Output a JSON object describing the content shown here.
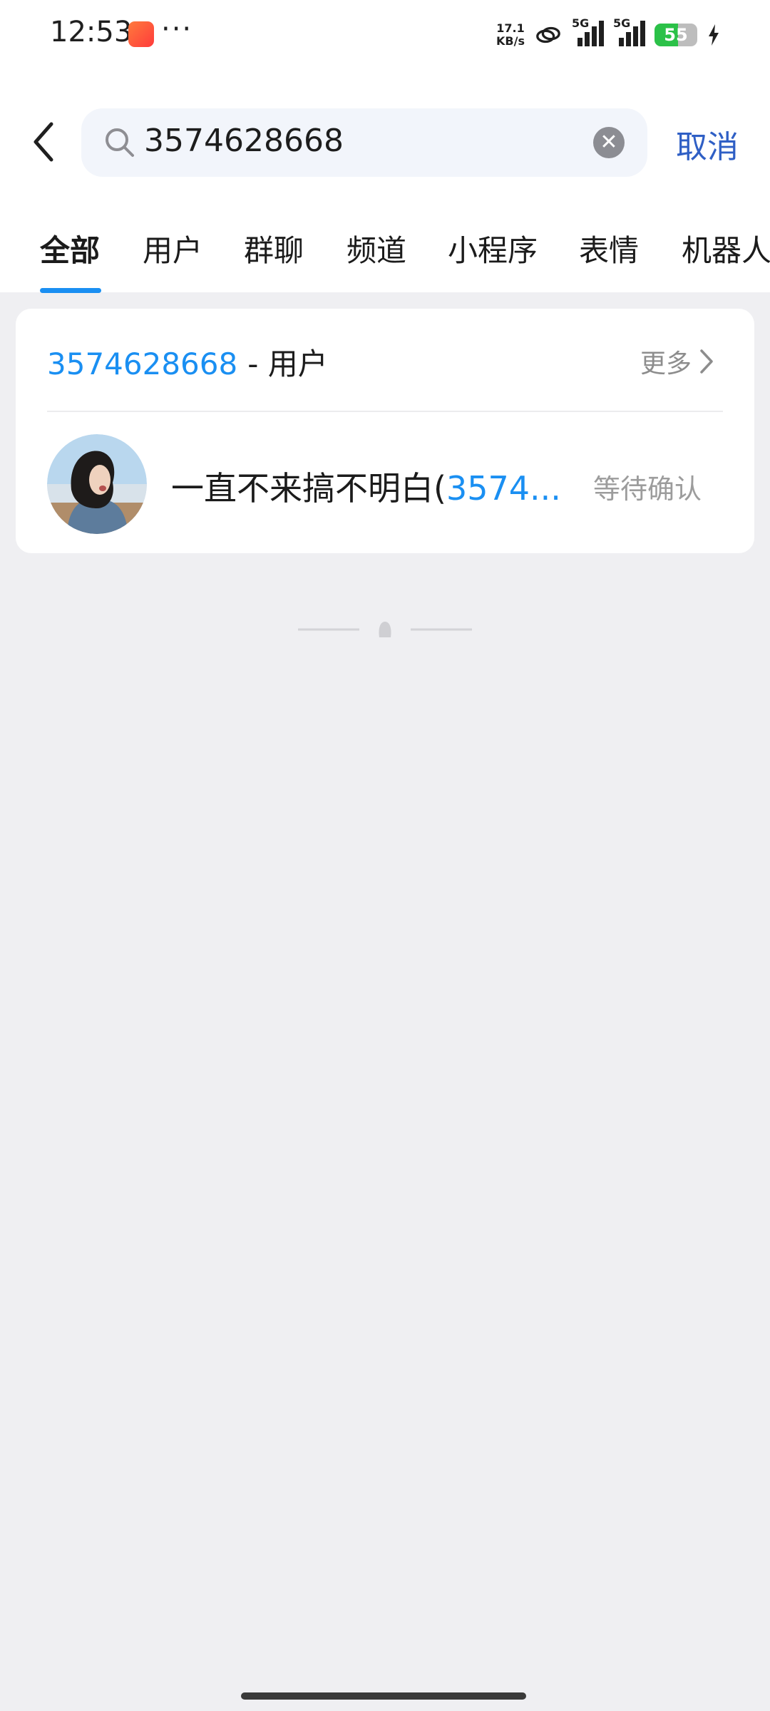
{
  "status_bar": {
    "time": "12:53",
    "more_dots": "···",
    "net_speed_value": "17.1",
    "net_speed_unit": "KB/s",
    "sim1_label": "5G",
    "sim2_label": "5G",
    "battery_level": "55",
    "battery_fraction": 0.55,
    "icons": [
      "app-notification-icon",
      "link-icon",
      "signal-icon",
      "battery-icon",
      "charging-bolt-icon"
    ]
  },
  "search": {
    "query": "3574628668",
    "cancel_label": "取消",
    "icons": [
      "back-arrow-icon",
      "search-icon",
      "clear-icon"
    ]
  },
  "tabs": [
    {
      "label": "全部",
      "active": true
    },
    {
      "label": "用户",
      "active": false
    },
    {
      "label": "群聊",
      "active": false
    },
    {
      "label": "频道",
      "active": false
    },
    {
      "label": "小程序",
      "active": false
    },
    {
      "label": "表情",
      "active": false
    },
    {
      "label": "机器人",
      "active": false
    }
  ],
  "section": {
    "highlight": "3574628668",
    "title_suffix": "- 用户",
    "more_label": "更多"
  },
  "result": {
    "name_plain": "一直不来搞不明白(",
    "name_highlight": "3574...",
    "status": "等待确认"
  },
  "colors": {
    "accent": "#1a8ff2",
    "cancel": "#2f5fc5",
    "background": "#efeff2"
  }
}
